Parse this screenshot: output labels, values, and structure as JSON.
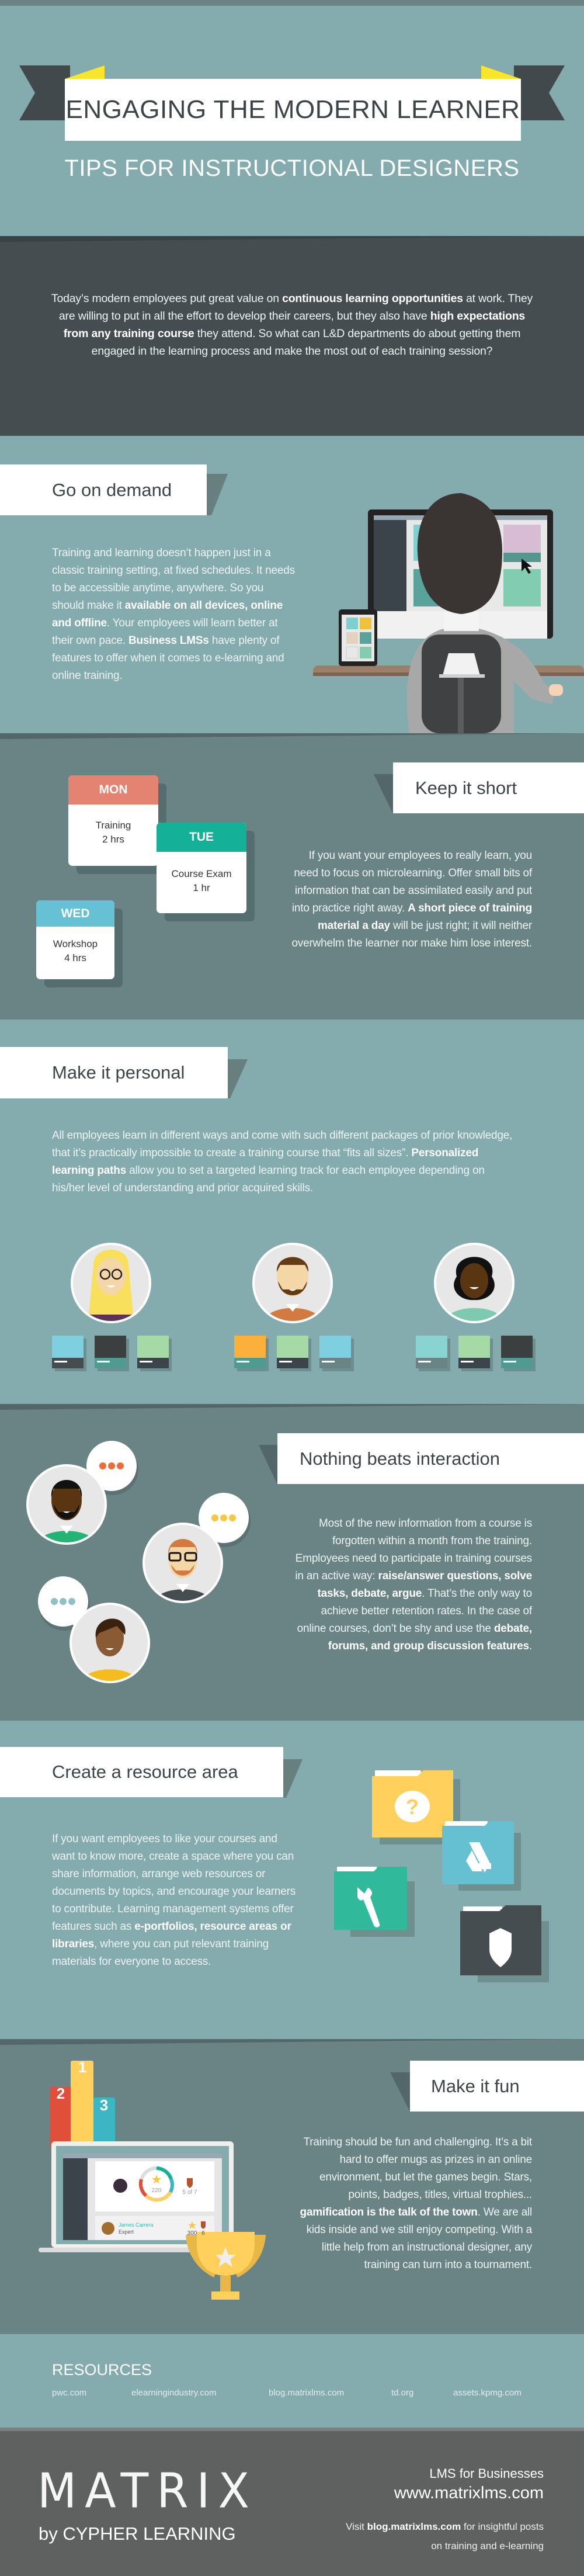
{
  "header": {
    "title": "ENGAGING THE MODERN LEARNER",
    "subtitle": "TIPS FOR INSTRUCTIONAL DESIGNERS"
  },
  "intro": {
    "text": [
      "Today’s modern employees put great value on ",
      "continuous learning opportunities",
      " at work. They are willing to put in all the effort to develop their careers, but they also have ",
      "high expectations from any training course",
      " they attend. So what can L&D departments do about getting them engaged in the learning process and make the most out of each training session?"
    ]
  },
  "on_demand": {
    "title": "Go on demand",
    "text": [
      "Training and learning doesn’t happen just in a classic training setting, at fixed schedules. It needs to be accessible anytime, anywhere. So you should make it ",
      "available on all devices, online and offline",
      ". Your employees will learn better at their own pace. ",
      "Business LMSs",
      " have plenty of features to offer when it comes to e-learning and online training."
    ]
  },
  "keep_short": {
    "title": "Keep it short",
    "cards": [
      {
        "day": "MON",
        "activity": "Training",
        "duration": "2 hrs",
        "color": "#e58373"
      },
      {
        "day": "TUE",
        "activity": "Course Exam",
        "duration": "1 hr",
        "color": "#14b097"
      },
      {
        "day": "WED",
        "activity": "Workshop",
        "duration": "4 hrs",
        "color": "#65c1d3"
      }
    ],
    "text": [
      "If you want your employees to really learn, you need to focus on microlearning. Offer small bits of information that can be assimilated easily and put into practice right away. ",
      "A short piece of training material a day",
      " will be just right; it will neither overwhelm the learner nor make him lose interest."
    ]
  },
  "personal": {
    "title": "Make it personal",
    "text": [
      "All employees learn in different ways and come with such different packages of prior knowledge, that it’s practically impossible to create a training course that “fits all sizes”. ",
      "Personalized learning paths",
      " allow you to set a targeted learning track for each employee depending on his/her level of understanding and prior acquired skills."
    ]
  },
  "interaction": {
    "title": "Nothing beats interaction",
    "text": [
      "Most of the new information from a course is forgotten within a month from the training. Employees need to participate in training courses in an active way: ",
      "raise/answer questions, solve tasks, debate, argue",
      ". That’s the only way to achieve better retention rates. In the case of online courses, don’t be shy and use the ",
      "debate, forums, and group discussion features",
      "."
    ]
  },
  "resource": {
    "title": "Create a resource area",
    "text": [
      "If you want employees to like your courses and want to know more, create a space where you can share information, arrange web resources or documents by topics, and encourage your learners to contribute. Learning management systems offer features such as ",
      "e-portfolios, resource areas or libraries",
      ", where you can put relevant training materials for everyone to access."
    ],
    "folder_icons": [
      "question-icon",
      "drive-icon",
      "wrench-icon",
      "shield-icon"
    ]
  },
  "fun": {
    "title": "Make it fun",
    "podium": [
      "1",
      "2",
      "3"
    ],
    "screen": {
      "points": "220",
      "badges": "5 of 7",
      "user_name": "James Carrera",
      "user_role": "Expert",
      "user_points": "300",
      "user_badges": "6"
    },
    "text": [
      "Training should be fun and challenging. It’s a bit hard to offer mugs as prizes in an online environment, but let the games begin. Stars, points, badges, titles, virtual trophies... ",
      "gamification is the talk of the town",
      ". We are all kids inside and we still enjoy competing. With a little help from an instructional designer, any training can turn into a tournament."
    ]
  },
  "resources": {
    "title": "RESOURCES",
    "links": [
      "pwc.com",
      "elearningindustry.com",
      "blog.matrixlms.com",
      "td.org",
      "assets.kpmg.com"
    ]
  },
  "footer": {
    "logo": "MATRIX",
    "byline": "by CYPHER LEARNING",
    "tagline": "LMS for Businesses",
    "url": "www.matrixlms.com",
    "visit": [
      "Visit ",
      "blog.matrixlms.com",
      " for insightful posts on training and e-learning"
    ]
  },
  "colors": {
    "teal_bg": "#84abad",
    "gray_bg": "#6a8385",
    "dark_bg": "#454d50",
    "footer_bg": "#5f6160",
    "accent_yellow": "#f9e62a"
  }
}
